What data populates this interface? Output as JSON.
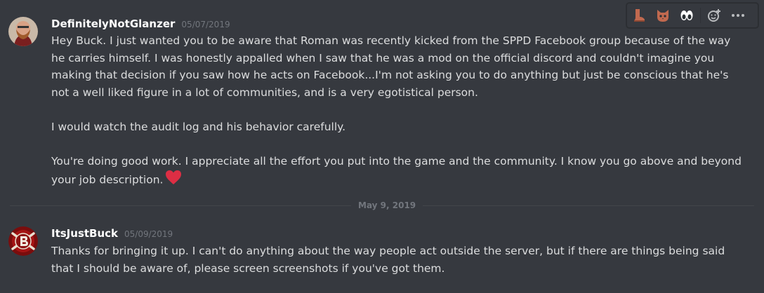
{
  "messages": [
    {
      "username": "DefinitelyNotGlanzer",
      "timestamp": "05/07/2019",
      "paragraphs": [
        "Hey Buck. I just wanted you to be aware that Roman was recently kicked from the SPPD Facebook group because of the way he carries himself. I was honestly appalled when I saw that he was a mod on the official discord and couldn't imagine you making that decision if you saw how he acts on Facebook...I'm not asking you to do anything but just be conscious that he's not a well liked figure in a lot of communities, and is a very egotistical person.",
        "I would watch the audit log and his behavior carefully.",
        "You're doing good work. I appreciate all the effort you put into the game and the community. I know you go above and beyond your job description."
      ]
    },
    {
      "username": "ItsJustBuck",
      "timestamp": "05/09/2019",
      "paragraphs": [
        "Thanks for bringing it up. I can't do anything about the way people act outside the server, but if there are things being said that I should be aware of, please screen screenshots if you've got them."
      ]
    }
  ],
  "date_divider": "May 9, 2019",
  "toolbar": {
    "icons": [
      "boot-emoji-icon",
      "cat-face-emoji-icon",
      "eyes-emoji-icon",
      "add-reaction-icon",
      "more-options-icon"
    ]
  },
  "colors": {
    "background": "#36393f",
    "username": "#ffffff",
    "text": "#dcddde",
    "muted": "#72767d",
    "heart": "#dd2e44"
  }
}
